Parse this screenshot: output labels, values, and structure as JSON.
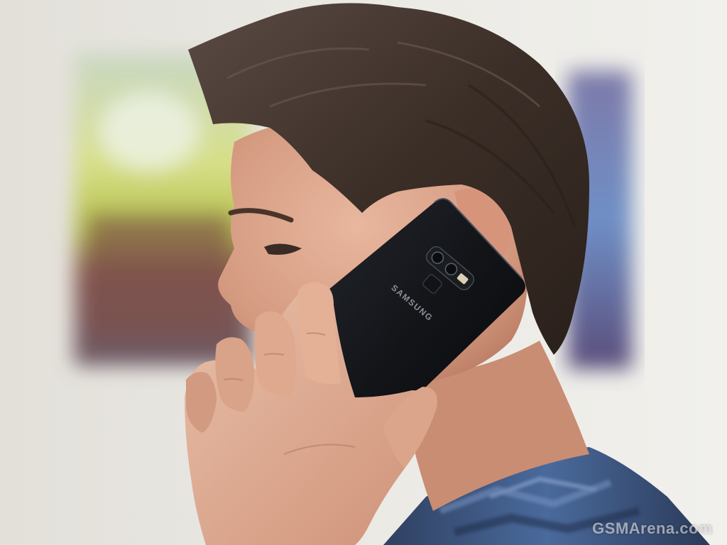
{
  "phone": {
    "brand": "SAMSUNG"
  },
  "watermark": {
    "text": "GSMArena.com"
  },
  "colors": {
    "wall": "#e9e7e2",
    "phone": "#101216",
    "shirt": "#3a4f70",
    "skin": "#d9a68c",
    "hair": "#3b2e27"
  }
}
